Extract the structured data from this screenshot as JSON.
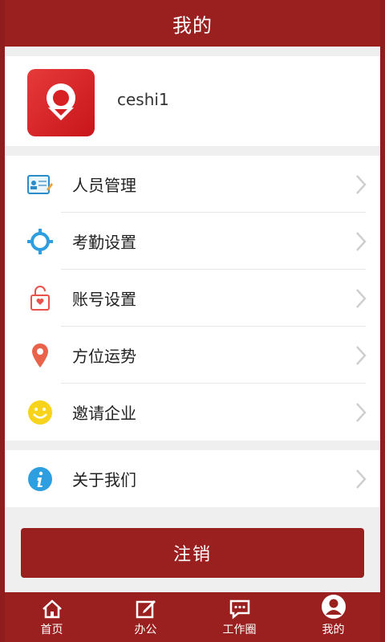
{
  "header": {
    "title": "我的"
  },
  "profile": {
    "username": "ceshi1"
  },
  "menu": [
    {
      "label": "人员管理",
      "icon": "id-card-icon"
    },
    {
      "label": "考勤设置",
      "icon": "gear-icon"
    },
    {
      "label": "账号设置",
      "icon": "lock-icon"
    },
    {
      "label": "方位运势",
      "icon": "location-pin-icon"
    },
    {
      "label": "邀请企业",
      "icon": "smiley-icon"
    }
  ],
  "menu2": [
    {
      "label": "关于我们",
      "icon": "info-icon"
    }
  ],
  "logout": {
    "label": "注销"
  },
  "tabs": [
    {
      "label": "首页",
      "icon": "home-icon"
    },
    {
      "label": "办公",
      "icon": "edit-icon"
    },
    {
      "label": "工作圈",
      "icon": "chat-icon"
    },
    {
      "label": "我的",
      "icon": "user-icon"
    }
  ],
  "colors": {
    "brand": "#9a2020",
    "background": "#efefef"
  }
}
